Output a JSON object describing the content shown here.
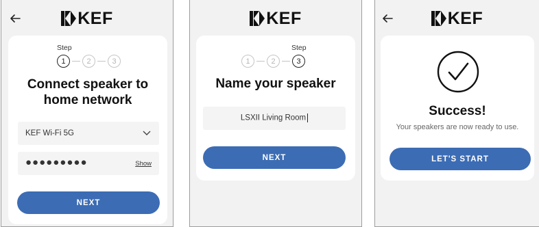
{
  "brand": "KEF",
  "screens": [
    {
      "step_label": "Step",
      "steps": [
        "1",
        "2",
        "3"
      ],
      "active_step": 1,
      "title_line1": "Connect speaker to",
      "title_line2": "home network",
      "network_value": "KEF Wi-Fi 5G",
      "password_mask": "●●●●●●●●●",
      "show_label": "Show",
      "button_label": "NEXT"
    },
    {
      "step_label": "Step",
      "steps": [
        "1",
        "2",
        "3"
      ],
      "active_step": 3,
      "title": "Name your speaker",
      "name_value": "LSXII Living Room",
      "button_label": "NEXT"
    },
    {
      "title": "Success!",
      "subtitle": "Your speakers are now ready to use.",
      "button_label": "LET'S START"
    }
  ],
  "colors": {
    "accent": "#3c6cb4",
    "panel_bg": "#f2f2f2",
    "card_bg": "#ffffff"
  },
  "icons": {
    "back": "arrow-left-icon",
    "dropdown": "chevron-down-icon",
    "success": "checkmark-circle-icon"
  }
}
